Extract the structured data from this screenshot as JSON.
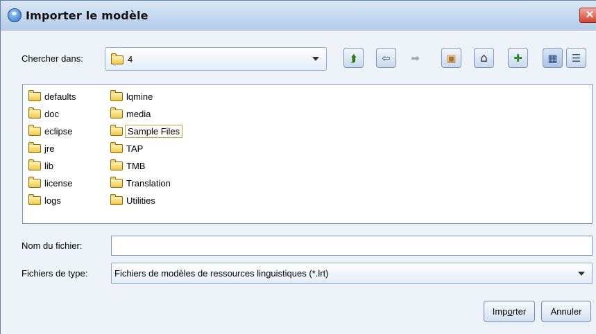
{
  "window": {
    "title": "Importer le modèle",
    "close_symbol": "✕"
  },
  "look_in": {
    "label": "Chercher dans:",
    "value": "4"
  },
  "toolbar": [
    {
      "name": "up-folder-icon",
      "glyph": "⮭"
    },
    {
      "name": "back-icon",
      "glyph": "⇦"
    },
    {
      "name": "forward-icon",
      "glyph": "➡"
    },
    {
      "name": "desktop-icon",
      "glyph": "▣"
    },
    {
      "name": "home-icon",
      "glyph": "⌂"
    },
    {
      "name": "new-folder-icon",
      "glyph": "✚"
    },
    {
      "name": "list-view-icon",
      "glyph": "▦"
    },
    {
      "name": "details-view-icon",
      "glyph": "☰"
    }
  ],
  "files": {
    "column1": [
      "defaults",
      "doc",
      "eclipse",
      "jre",
      "lib",
      "license",
      "logs"
    ],
    "column2": [
      "lqmine",
      "media",
      "Sample Files",
      "TAP",
      "TMB",
      "Translation",
      "Utilities"
    ],
    "selected": "Sample Files"
  },
  "filename": {
    "label": "Nom du fichier:",
    "value": ""
  },
  "filetype": {
    "label": "Fichiers de type:",
    "value": "Fichiers de modèles de ressources linguistiques (*.lrt)"
  },
  "buttons": {
    "import": {
      "pre": "Imp",
      "mnemonic": "o",
      "post": "rter"
    },
    "cancel": "Annuler"
  }
}
